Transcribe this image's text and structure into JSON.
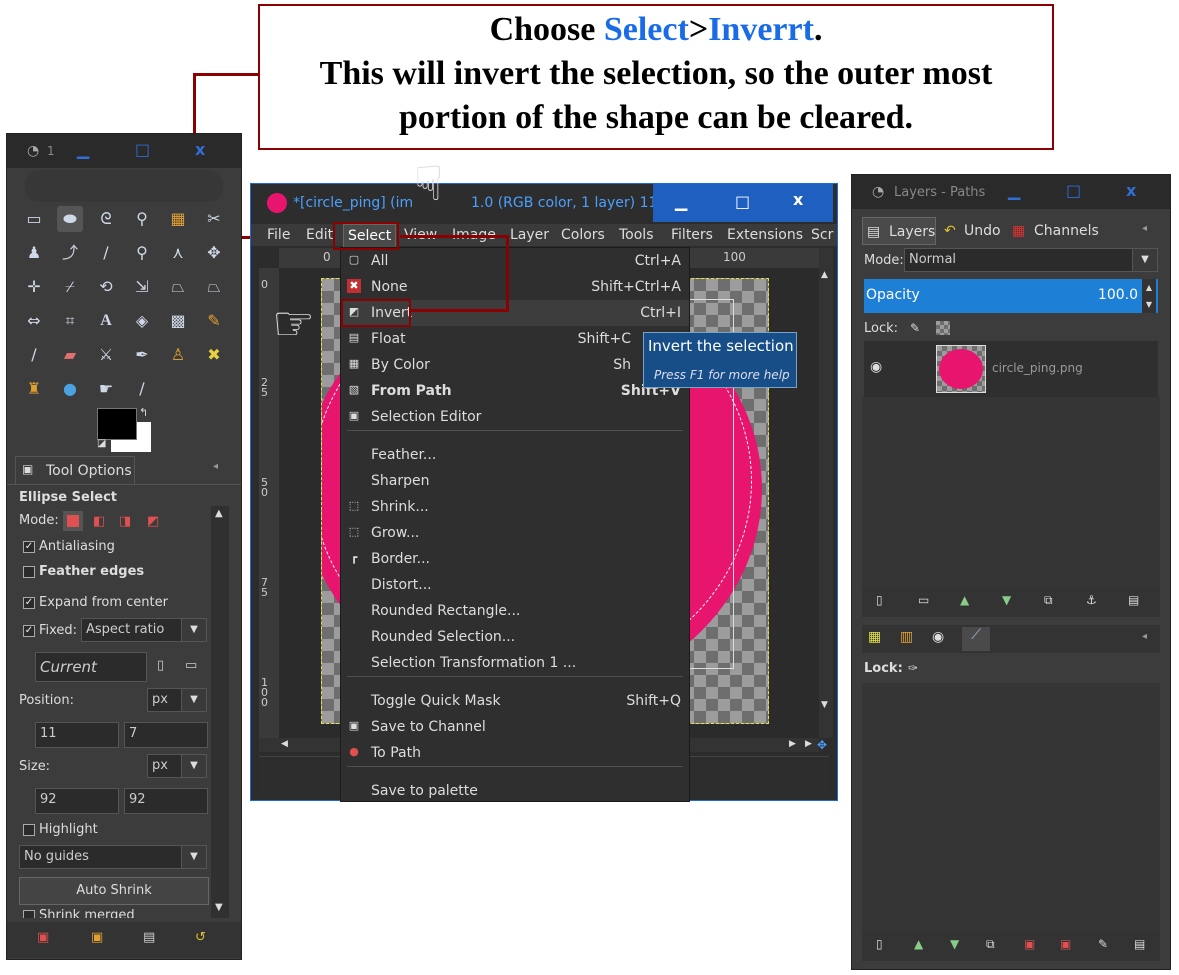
{
  "callout": {
    "line1_prefix": "Choose ",
    "line1_select": "Select",
    "line1_gt": ">",
    "line1_invert": "Inverrt",
    "line1_dot": ".",
    "line2": "This will invert the selection, so the outer most",
    "line3": "portion of the shape can be cleared."
  },
  "toolbox": {
    "title_num": "1",
    "tool_options_tab": "Tool Options",
    "tool_name": "Ellipse Select",
    "mode_label": "Mode:",
    "antialiasing": "Antialiasing",
    "feather_edges": "Feather edges",
    "expand_from_center": "Expand from center",
    "fixed_label": "Fixed:",
    "fixed_value": "Aspect ratio",
    "current_value": "Current",
    "position_label": "Position:",
    "position_unit": "px",
    "pos_x": "11",
    "pos_y": "7",
    "size_label": "Size:",
    "size_unit": "px",
    "size_w": "92",
    "size_h": "92",
    "highlight": "Highlight",
    "guides": "No guides",
    "auto_shrink": "Auto Shrink",
    "shrink_merged": "Shrink merged"
  },
  "image_window": {
    "title": "*[circle_ping] (im",
    "title_rest": "1.0 (RGB color, 1 layer) 112...",
    "menubar": [
      "File",
      "Edit",
      "Select",
      "View",
      "Image",
      "Layer",
      "Colors",
      "Tools",
      "Filters",
      "Extensions",
      "Scr"
    ],
    "ruler_top_0": "0",
    "ruler_top_100": "100",
    "ruler_left": [
      "0",
      "2 5",
      "5 0",
      "7 5",
      "1 0 0"
    ]
  },
  "select_menu": {
    "items": [
      {
        "label": "All",
        "shortcut": "Ctrl+A",
        "icon": "select-all-icon",
        "glyph": "▢"
      },
      {
        "label": "None",
        "shortcut": "Shift+Ctrl+A",
        "icon": "select-none-icon",
        "glyph": "✖"
      },
      {
        "label": "Invert",
        "shortcut": "Ctrl+I",
        "icon": "select-invert-icon",
        "glyph": "◩"
      },
      {
        "label": "Float",
        "shortcut": "Shift+C",
        "icon": "float-icon",
        "glyph": "▤"
      },
      {
        "label": "By Color",
        "shortcut": "Sh",
        "icon": "by-color-icon",
        "glyph": "▦"
      },
      {
        "label": "From Path",
        "shortcut": "Shift+V",
        "icon": "from-path-icon",
        "glyph": "▧"
      },
      {
        "label": "Selection Editor",
        "shortcut": "",
        "icon": "selection-editor-icon",
        "glyph": "▣"
      },
      {
        "label": "Feather...",
        "shortcut": "",
        "icon": "",
        "glyph": ""
      },
      {
        "label": "Sharpen",
        "shortcut": "",
        "icon": "",
        "glyph": ""
      },
      {
        "label": "Shrink...",
        "shortcut": "",
        "icon": "shrink-icon",
        "glyph": "⬚"
      },
      {
        "label": "Grow...",
        "shortcut": "",
        "icon": "grow-icon",
        "glyph": "⬚"
      },
      {
        "label": "Border...",
        "shortcut": "",
        "icon": "border-icon",
        "glyph": "┏"
      },
      {
        "label": "Distort...",
        "shortcut": "",
        "icon": "",
        "glyph": ""
      },
      {
        "label": "Rounded Rectangle...",
        "shortcut": "",
        "icon": "",
        "glyph": ""
      },
      {
        "label": "Rounded Selection...",
        "shortcut": "",
        "icon": "",
        "glyph": ""
      },
      {
        "label": "Selection Transformation 1 ...",
        "shortcut": "",
        "icon": "",
        "glyph": ""
      },
      {
        "label": "Toggle Quick Mask",
        "shortcut": "Shift+Q",
        "icon": "",
        "glyph": ""
      },
      {
        "label": "Save to Channel",
        "shortcut": "",
        "icon": "save-to-channel-icon",
        "glyph": "▣"
      },
      {
        "label": "To Path",
        "shortcut": "",
        "icon": "to-path-icon",
        "glyph": "●"
      },
      {
        "label": "Save to palette",
        "shortcut": "",
        "icon": "",
        "glyph": ""
      }
    ]
  },
  "tooltip": {
    "title": "Invert the selection",
    "hint": "Press F1 for more help"
  },
  "layers_dock": {
    "title": "Layers - Paths",
    "tab_layers": "Layers",
    "tab_undo": "Undo",
    "tab_channels": "Channels",
    "mode_label": "Mode:",
    "mode_value": "Normal",
    "opacity_label": "Opacity",
    "opacity_value": "100.0",
    "lock_label": "Lock:",
    "layer_name": "circle_ping.png",
    "lock_label2": "Lock:"
  },
  "colors": {
    "accent": "#1a6be6",
    "callout_border": "#8b0000",
    "pink": "#e8156f",
    "opacity_bar": "#1e7fd6"
  }
}
